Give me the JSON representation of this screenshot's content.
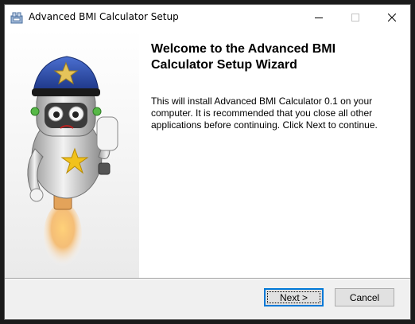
{
  "window": {
    "title": "Advanced BMI Calculator Setup",
    "icon": "installer-icon",
    "controls": {
      "minimize_icon": "minimize-icon",
      "maximize_icon": "maximize-icon",
      "close_icon": "close-icon"
    }
  },
  "wizard": {
    "heading": "Welcome to the Advanced BMI Calculator Setup Wizard",
    "description": "This will install Advanced BMI Calculator 0.1 on your computer. It is recommended that you close all other applications before continuing. Click Next to continue.",
    "image": "robot-police-mascot"
  },
  "buttons": {
    "next": "Next >",
    "cancel": "Cancel"
  },
  "colors": {
    "accent": "#0078d7",
    "panel_bg": "#ffffff",
    "footer_bg": "#f0f0f0"
  }
}
